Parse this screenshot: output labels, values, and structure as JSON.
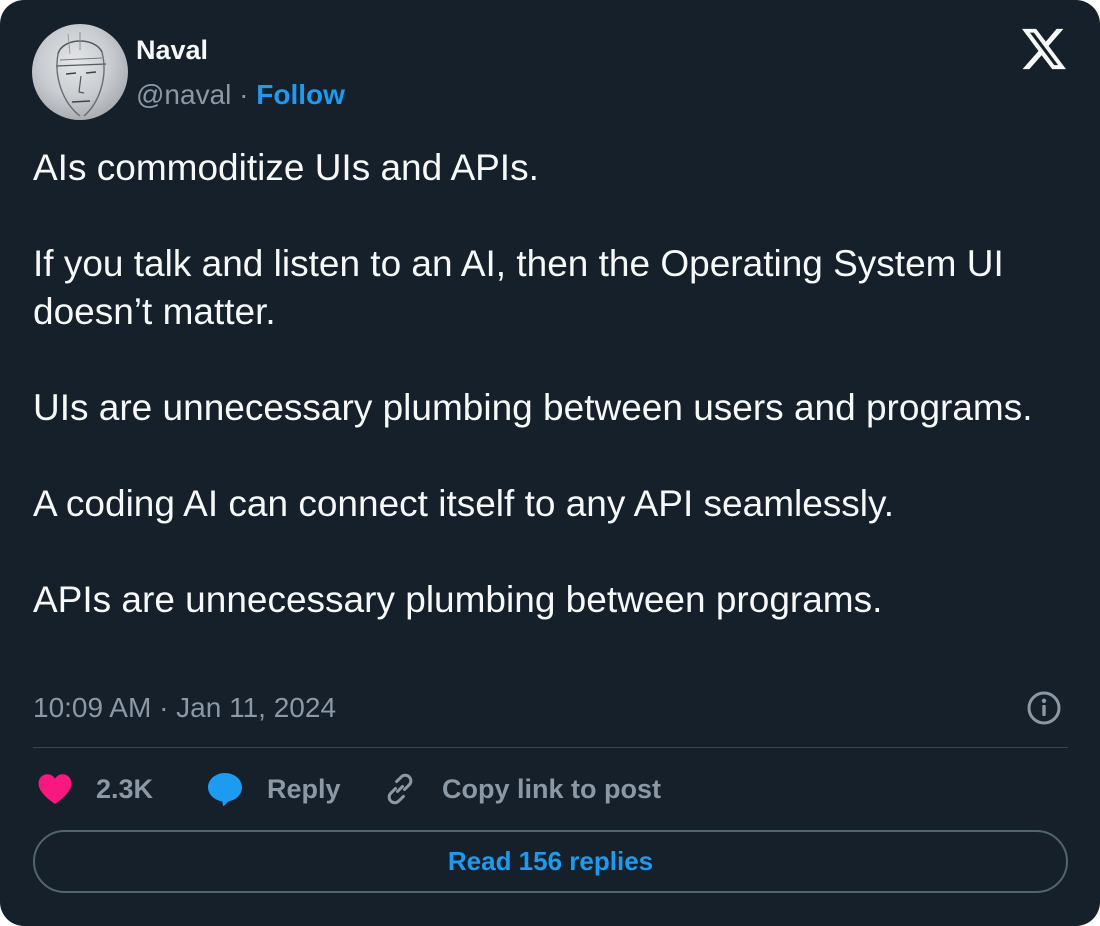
{
  "author": {
    "display_name": "Naval",
    "handle": "@naval",
    "separator": " · ",
    "follow_label": "Follow"
  },
  "tweet": {
    "paragraphs": [
      "AIs commoditize UIs and APIs.",
      "If you talk and listen to an AI, then the Operating System UI doesn’t matter.",
      "UIs are unnecessary plumbing between users and programs.",
      "A coding AI can connect itself to any API seamlessly.",
      "APIs are unnecessary plumbing between programs."
    ],
    "timestamp": "10:09 AM · Jan 11, 2024"
  },
  "actions": {
    "like_count": "2.3K",
    "reply_label": "Reply",
    "copy_link_label": "Copy link to post"
  },
  "read_replies_label": "Read 156 replies",
  "icons": {
    "logo": "x-logo-icon",
    "info": "info-icon",
    "like": "heart-icon",
    "reply": "speech-bubble-icon",
    "copy": "link-icon"
  },
  "colors": {
    "background": "#15202b",
    "text": "#f7f9f9",
    "muted": "#8b98a5",
    "accent": "#1d9bf0",
    "like": "#f91880",
    "border": "#38444d"
  }
}
